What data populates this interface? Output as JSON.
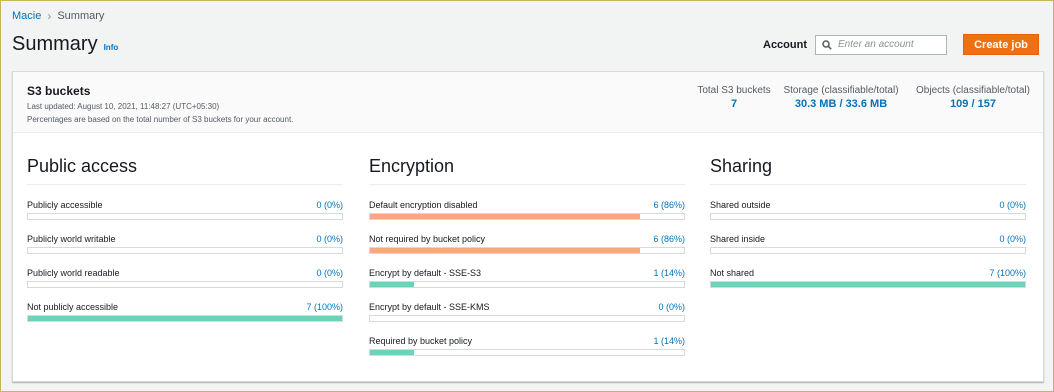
{
  "breadcrumb": {
    "root": "Macie",
    "current": "Summary"
  },
  "header": {
    "title": "Summary",
    "info": "Info",
    "account_label": "Account",
    "account_placeholder": "Enter an account",
    "create_job": "Create job"
  },
  "s3": {
    "title": "S3 buckets",
    "last_updated": "Last updated: August 10, 2021, 11:48:27 (UTC+05:30)",
    "note": "Percentages are based on the total number of S3 buckets for your account.",
    "stats": [
      {
        "label": "Total S3 buckets",
        "value": "7"
      },
      {
        "label": "Storage (classifiable/total)",
        "value": "30.3 MB / 33.6 MB"
      },
      {
        "label": "Objects (classifiable/total)",
        "value": "109 / 157"
      }
    ]
  },
  "colors": {
    "green": "#6fd2b8",
    "orange": "#f5a882",
    "link": "#0073bb",
    "button": "#ec7211"
  },
  "sections": [
    {
      "title": "Public access",
      "metrics": [
        {
          "label": "Publicly accessible",
          "value": "0 (0%)",
          "fraction": 0,
          "color": "green"
        },
        {
          "label": "Publicly world writable",
          "value": "0 (0%)",
          "fraction": 0,
          "color": "green"
        },
        {
          "label": "Publicly world readable",
          "value": "0 (0%)",
          "fraction": 0,
          "color": "green"
        },
        {
          "label": "Not publicly accessible",
          "value": "7 (100%)",
          "fraction": 1,
          "color": "green"
        }
      ]
    },
    {
      "title": "Encryption",
      "metrics": [
        {
          "label": "Default encryption disabled",
          "value": "6 (86%)",
          "fraction": 0.86,
          "color": "orange"
        },
        {
          "label": "Not required by bucket policy",
          "value": "6 (86%)",
          "fraction": 0.86,
          "color": "orange"
        },
        {
          "label": "Encrypt by default - SSE-S3",
          "value": "1 (14%)",
          "fraction": 0.14,
          "color": "green"
        },
        {
          "label": "Encrypt by default - SSE-KMS",
          "value": "0 (0%)",
          "fraction": 0,
          "color": "green"
        },
        {
          "label": "Required by bucket policy",
          "value": "1 (14%)",
          "fraction": 0.14,
          "color": "green"
        }
      ]
    },
    {
      "title": "Sharing",
      "metrics": [
        {
          "label": "Shared outside",
          "value": "0 (0%)",
          "fraction": 0,
          "color": "green"
        },
        {
          "label": "Shared inside",
          "value": "0 (0%)",
          "fraction": 0,
          "color": "green"
        },
        {
          "label": "Not shared",
          "value": "7 (100%)",
          "fraction": 1,
          "color": "green"
        }
      ]
    }
  ]
}
